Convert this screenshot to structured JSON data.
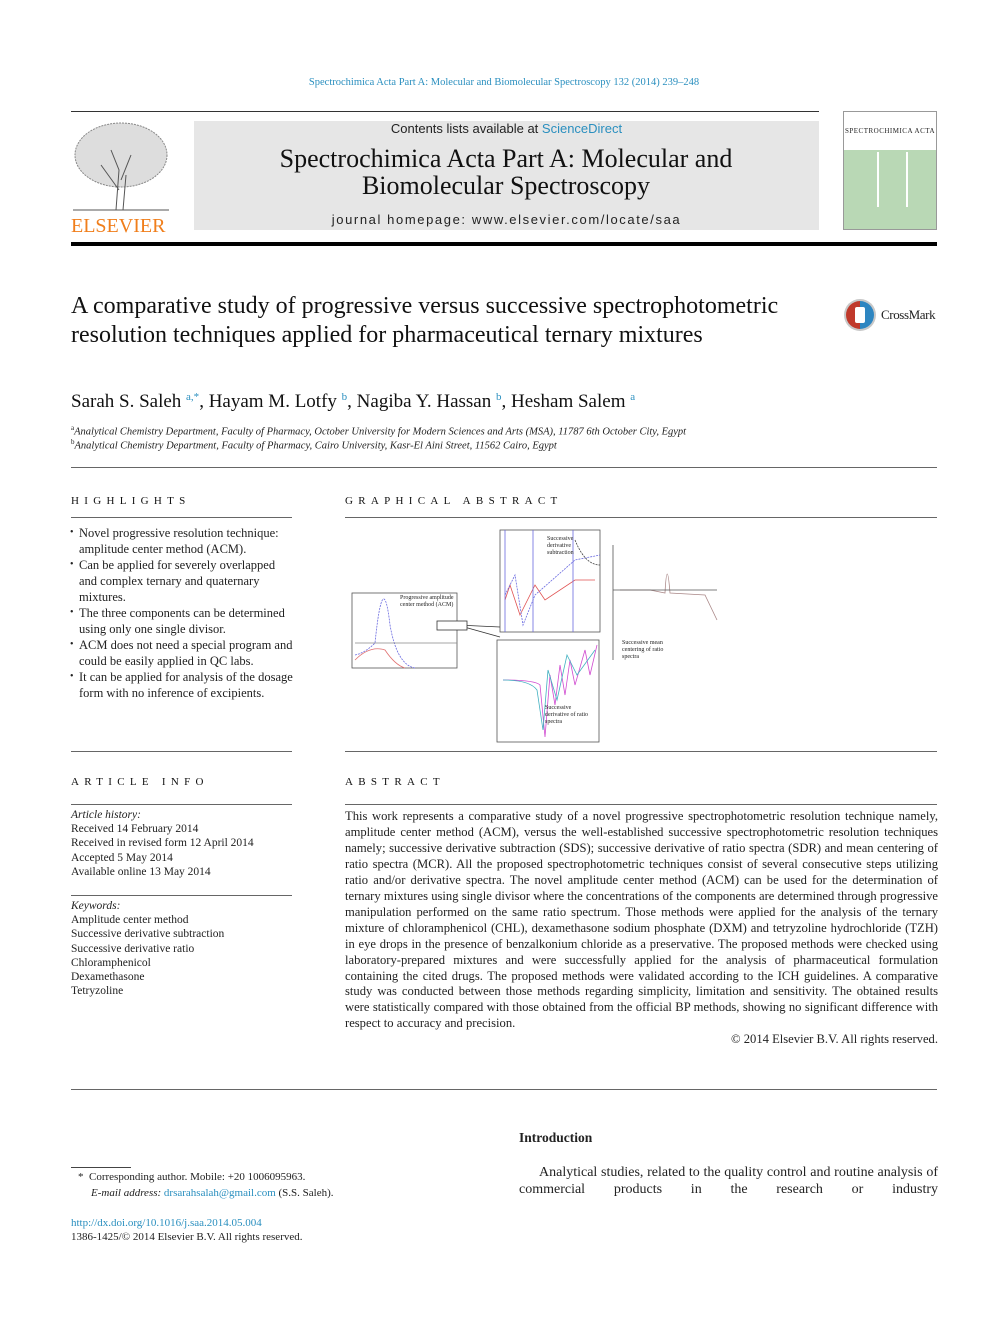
{
  "journal_ref": "Spectrochimica Acta Part A: Molecular and Biomolecular Spectroscopy 132 (2014) 239–248",
  "header": {
    "contents_prefix": "Contents lists available at ",
    "contents_link": "ScienceDirect",
    "journal_title": "Spectrochimica Acta Part A: Molecular and Biomolecular Spectroscopy",
    "homepage": "journal homepage: www.elsevier.com/locate/saa",
    "publisher_logo": "ELSEVIER",
    "cover_text": "SPECTROCHIMICA ACTA",
    "colors": {
      "link": "#2a8fbf",
      "elsevier": "#f07e1b",
      "cover": "#b9d8b5"
    }
  },
  "article": {
    "title": "A comparative study of progressive versus successive spectrophotometric resolution techniques applied for pharmaceutical ternary mixtures",
    "crossmark": "CrossMark",
    "authors": [
      {
        "name": "Sarah S. Saleh",
        "sup": "a,*"
      },
      {
        "name": "Hayam M. Lotfy",
        "sup": "b"
      },
      {
        "name": "Nagiba Y. Hassan",
        "sup": "b"
      },
      {
        "name": "Hesham Salem",
        "sup": "a"
      }
    ],
    "affiliations": [
      {
        "sup": "a",
        "text": "Analytical Chemistry Department, Faculty of Pharmacy, October University for Modern Sciences and Arts (MSA), 11787 6th October City, Egypt"
      },
      {
        "sup": "b",
        "text": "Analytical Chemistry Department, Faculty of Pharmacy, Cairo University, Kasr-El Aini Street, 11562 Cairo, Egypt"
      }
    ]
  },
  "highlights": {
    "heading": "HIGHLIGHTS",
    "items": [
      "Novel progressive resolution technique: amplitude center method (ACM).",
      "Can be applied for severely overlapped and complex ternary and quaternary mixtures.",
      "The three components can be determined using only one single divisor.",
      "ACM does not need a special program and could be easily applied in QC labs.",
      "It can be applied for analysis of the dosage form with no inference of excipients."
    ]
  },
  "graphical_abstract": {
    "heading": "GRAPHICAL ABSTRACT",
    "labels": {
      "acm": "Progressive amplitude center method (ACM)",
      "sds": "Successive derivative subtraction",
      "mcr": "Successive mean centering of ratio spectra",
      "sdr": "Successive derivative of ratio spectra"
    }
  },
  "article_info": {
    "heading": "ARTICLE INFO",
    "history_label": "Article history:",
    "history": [
      "Received 14 February 2014",
      "Received in revised form 12 April 2014",
      "Accepted 5 May 2014",
      "Available online 13 May 2014"
    ],
    "keywords_label": "Keywords:",
    "keywords": [
      "Amplitude center method",
      "Successive derivative subtraction",
      "Successive derivative ratio",
      "Chloramphenicol",
      "Dexamethasone",
      "Tetryzoline"
    ]
  },
  "abstract": {
    "heading": "ABSTRACT",
    "text": "This work represents a comparative study of a novel progressive spectrophotometric resolution technique namely, amplitude center method (ACM), versus the well-established successive spectrophotometric resolution techniques namely; successive derivative subtraction (SDS); successive derivative of ratio spectra (SDR) and mean centering of ratio spectra (MCR). All the proposed spectrophotometric techniques consist of several consecutive steps utilizing ratio and/or derivative spectra. The novel amplitude center method (ACM) can be used for the determination of ternary mixtures using single divisor where the concentrations of the components are determined through progressive manipulation performed on the same ratio spectrum. Those methods were applied for the analysis of the ternary mixture of chloramphenicol (CHL), dexamethasone sodium phosphate (DXM) and tetryzoline hydrochloride (TZH) in eye drops in the presence of benzalkonium chloride as a preservative. The proposed methods were checked using laboratory-prepared mixtures and were successfully applied for the analysis of pharmaceutical formulation containing the cited drugs. The proposed methods were validated according to the ICH guidelines. A comparative study was conducted between those methods regarding simplicity, limitation and sensitivity. The obtained results were statistically compared with those obtained from the official BP methods, showing no significant difference with respect to accuracy and precision.",
    "copyright": "© 2014 Elsevier B.V. All rights reserved."
  },
  "introduction": {
    "heading": "Introduction",
    "text": "Analytical studies, related to the quality control and routine analysis of commercial products in the research or industry"
  },
  "footnotes": {
    "corresponding_mark": "*",
    "corresponding": "Corresponding author. Mobile: +20 1006095963.",
    "email_label": "E-mail address:",
    "email": "drsarahsalah@gmail.com",
    "email_suffix": "(S.S. Saleh).",
    "doi": "http://dx.doi.org/10.1016/j.saa.2014.05.004",
    "issn": "1386-1425/© 2014 Elsevier B.V. All rights reserved."
  }
}
